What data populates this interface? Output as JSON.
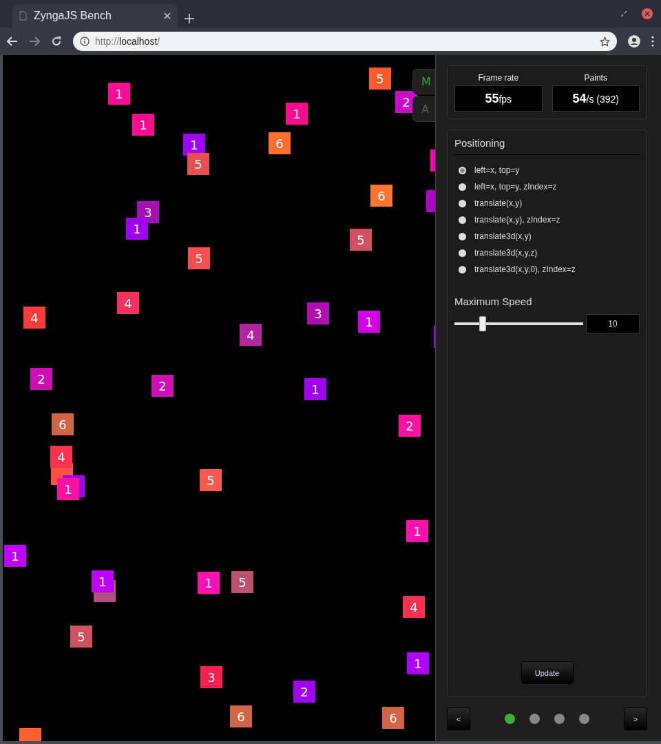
{
  "browser": {
    "tab_title": "ZyngaJS Bench",
    "url_scheme": "http://",
    "url_host": "localhost",
    "url_path": "/"
  },
  "canvas": {
    "side_tabs": [
      {
        "label": "M",
        "selected": true
      },
      {
        "label": "A",
        "selected": false
      }
    ],
    "tiles": [
      {
        "label": "5",
        "color": "#ff5a2a"
      },
      {
        "label": "1",
        "color": "#ff0a96"
      },
      {
        "label": "2",
        "color": "#cc08cc"
      },
      {
        "label": "1",
        "color": "#ff0a90"
      },
      {
        "label": "1",
        "color": "#ff0a90"
      },
      {
        "label": "1",
        "color": "#a000ff"
      },
      {
        "label": "6",
        "color": "#ff6e2e"
      },
      {
        "label": "5",
        "color": "#e85050"
      },
      {
        "color": "#ff00b0"
      },
      {
        "color": "#b000cc"
      },
      {
        "label": "6",
        "color": "#ff7430"
      },
      {
        "label": "3",
        "color": "#a410b4"
      },
      {
        "label": "1",
        "color": "#a000f0"
      },
      {
        "label": "5",
        "color": "#d05060"
      },
      {
        "label": "5",
        "color": "#f84e50"
      },
      {
        "label": "4",
        "color": "#f83060"
      },
      {
        "label": "4",
        "color": "#ff3a3a"
      },
      {
        "label": "3",
        "color": "#b010b0"
      },
      {
        "label": "1",
        "color": "#d000e0"
      },
      {
        "label": "4",
        "color": "#b424a0"
      },
      {
        "color": "#a800f0"
      },
      {
        "label": "2",
        "color": "#cc10b4"
      },
      {
        "label": "2",
        "color": "#cc10b4"
      },
      {
        "label": "1",
        "color": "#a000f0"
      },
      {
        "label": "6",
        "color": "#d06444"
      },
      {
        "label": "2",
        "color": "#ff10a0"
      },
      {
        "color": "#ff5040"
      },
      {
        "label": "4",
        "color": "#ff3050"
      },
      {
        "color": "#a000f0"
      },
      {
        "label": "1",
        "color": "#ff10a0"
      },
      {
        "label": "5",
        "color": "#f85a50"
      },
      {
        "label": "1",
        "color": "#ff10b0"
      },
      {
        "label": "1",
        "color": "#c000ff"
      },
      {
        "color": "#b05080"
      },
      {
        "label": "1",
        "color": "#c000ff"
      },
      {
        "label": "1",
        "color": "#ff10b0"
      },
      {
        "label": "5",
        "color": "#c05070"
      },
      {
        "label": "4",
        "color": "#f83050"
      },
      {
        "label": "5",
        "color": "#d05060"
      },
      {
        "label": "1",
        "color": "#b000ff"
      },
      {
        "label": "3",
        "color": "#ff2050"
      },
      {
        "label": "2",
        "color": "#a000f0"
      },
      {
        "label": "6",
        "color": "#d06444"
      },
      {
        "label": "6",
        "color": "#d06444"
      },
      {
        "color": "#ff6030"
      }
    ]
  },
  "stats": [
    {
      "title": "Frame rate",
      "value": "55",
      "unit": "fps"
    },
    {
      "title": "Paints",
      "value": "54",
      "unit": "/s",
      "extra": "(392)"
    }
  ],
  "positioning": {
    "title": "Positioning",
    "options": [
      {
        "label": "left=x, top=y",
        "selected": true
      },
      {
        "label": "left=x, top=y, zIndex=z",
        "selected": false
      },
      {
        "label": "translate(x,y)",
        "selected": false
      },
      {
        "label": "translate(x,y), zIndex=z",
        "selected": false
      },
      {
        "label": "translate3d(x,y)",
        "selected": false
      },
      {
        "label": "translate3d(x,y,z)",
        "selected": false
      },
      {
        "label": "translate3d(x,y,0), zIndex=z",
        "selected": false
      }
    ]
  },
  "speed": {
    "title": "Maximum Speed",
    "level": 0.22,
    "value": "10"
  },
  "update_button": "Update",
  "pager": {
    "prev": "<",
    "next": ">",
    "dots": [
      {
        "selected": true
      },
      {
        "selected": false
      },
      {
        "selected": false
      },
      {
        "selected": false
      }
    ]
  }
}
